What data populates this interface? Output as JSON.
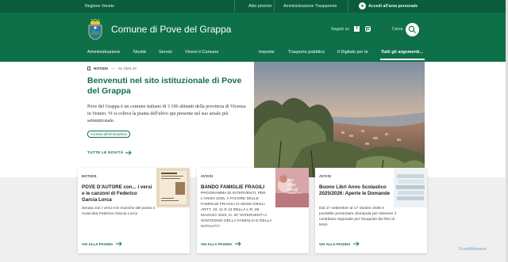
{
  "topbar": {
    "region": "Regione Veneto",
    "links": [
      "Albo pretorio",
      "Amministrazione Trasparente"
    ],
    "login": "Accedi all'area personale"
  },
  "header": {
    "site_name": "Comune di Pove del Grappa",
    "social_label": "Seguici su",
    "search_label": "Cerca"
  },
  "nav": {
    "left": [
      "Amministrazione",
      "Novità",
      "Servizi",
      "Vivere il Comune"
    ],
    "right": [
      "Imposte",
      "Trasporto pubblico",
      "Il Digitale per te",
      "Tutti gli argomenti..."
    ]
  },
  "hero": {
    "kind": "NOTIZIA",
    "date": "01 GEN 23",
    "title": "Benvenuti nel sito istituzionale di Pove del Grappa",
    "body": "Pove del Grappa è un comune italiano di 3 106 abitanti della provincia di Vicenza in Veneto. Vi si coltiva la pianta dell'ulivo qui presente nel suo areale più settentrionale.",
    "chip": "Accesso all'informazione",
    "all_news": "TUTTE LE NOVITÀ"
  },
  "cards": [
    {
      "kind": "NOTIZIE",
      "title": "POVE D'AUTORE con... i versi e le canzoni di Federico Garcia Lorca",
      "body": "Serata con i versi e le musiche del poeta e musicista Federico Garcia Lorca",
      "more": "VAI ALLA PAGINA"
    },
    {
      "kind": "AVVISI",
      "title": "BANDO FAMIGLIE FRAGILI",
      "body": "PROGRAMMA DI INTERVENTI, PER L'ANNO 2025, A FAVORE DELLE FAMIGLIE FRAGILI AI SENSI DEGLI ARTT. 10, 11 E 13 DELLA L.R. 28 MAGGIO 2020, N. 20 \"INTERVENTI A SOSTEGNO DELLA FAMIGLIA E DELLA NATALITÀ\"",
      "more": "VAI ALLA PAGINA",
      "thumb_text": [
        "Inte",
        "a fav",
        "famigl",
        "residen in V"
      ]
    },
    {
      "kind": "AVVISI",
      "title": "Buono Libri Anno Scolastico 2025/2026: Aperte le Domande",
      "body": "Dal 17 settembre al 17 ottobre 2025 è possibile presentare domanda per ottenere il contributo regionale per l'acquisto dei libri di testo",
      "more": "VAI ALLA PAGINA"
    }
  ],
  "watermark": "ScanMalware",
  "colors": {
    "brand": "#0e7048",
    "brand_dark": "#0a5c3c",
    "band": "#efefef"
  }
}
